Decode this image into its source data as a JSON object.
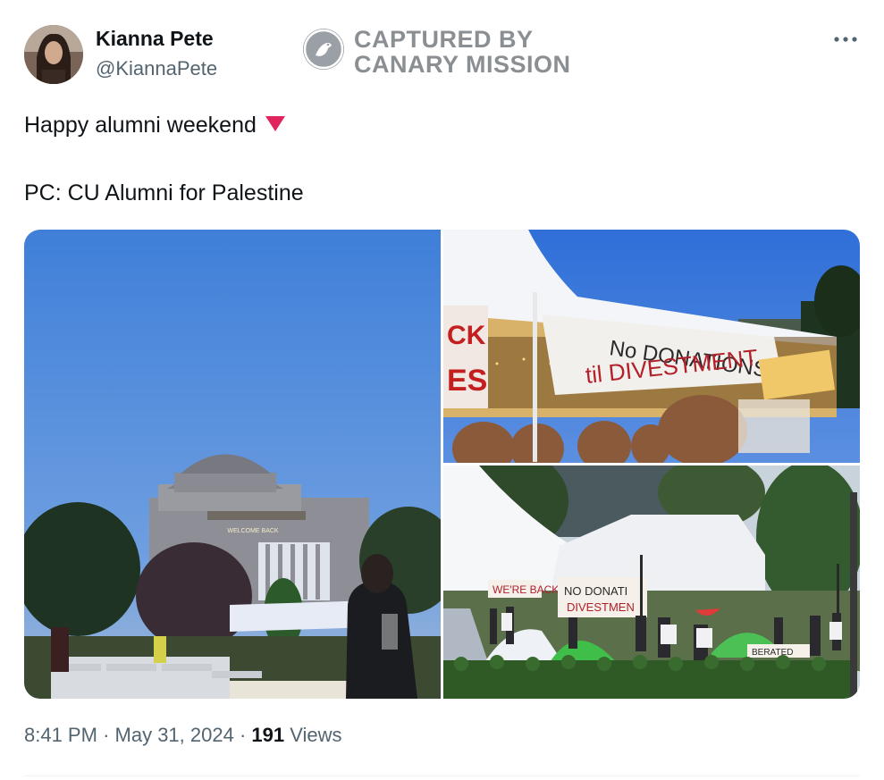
{
  "author": {
    "name": "Kianna Pete",
    "handle": "@KiannaPete"
  },
  "watermark": {
    "line1": "CAPTURED BY",
    "line2": "CANARY MISSION"
  },
  "tweet": {
    "line1": "Happy alumni weekend",
    "line2": "PC: CU Alumni for Palestine"
  },
  "media": {
    "photo1_sign": "WELCOME BACK",
    "photo2_banner": [
      "No DONATIONS",
      "til DIVESTMENT"
    ],
    "photo2_sign_left": [
      "CK",
      "ES"
    ],
    "photo3_banner_left": "WE'RE BACK",
    "photo3_banner_right": [
      "NO DONATI",
      "DIVESTMEN"
    ],
    "photo3_banner_bottom": "BERATED"
  },
  "meta": {
    "time": "8:41 PM",
    "separator": "·",
    "date": "May 31, 2024",
    "views_count": "191",
    "views_label": "Views"
  },
  "colors": {
    "heart": "#e0245e",
    "text_primary": "#0f1419",
    "text_secondary": "#536471"
  },
  "icons": {
    "more": "more-horizontal-icon",
    "heart": "red-heart-icon",
    "watermark": "canary-bird-icon"
  }
}
